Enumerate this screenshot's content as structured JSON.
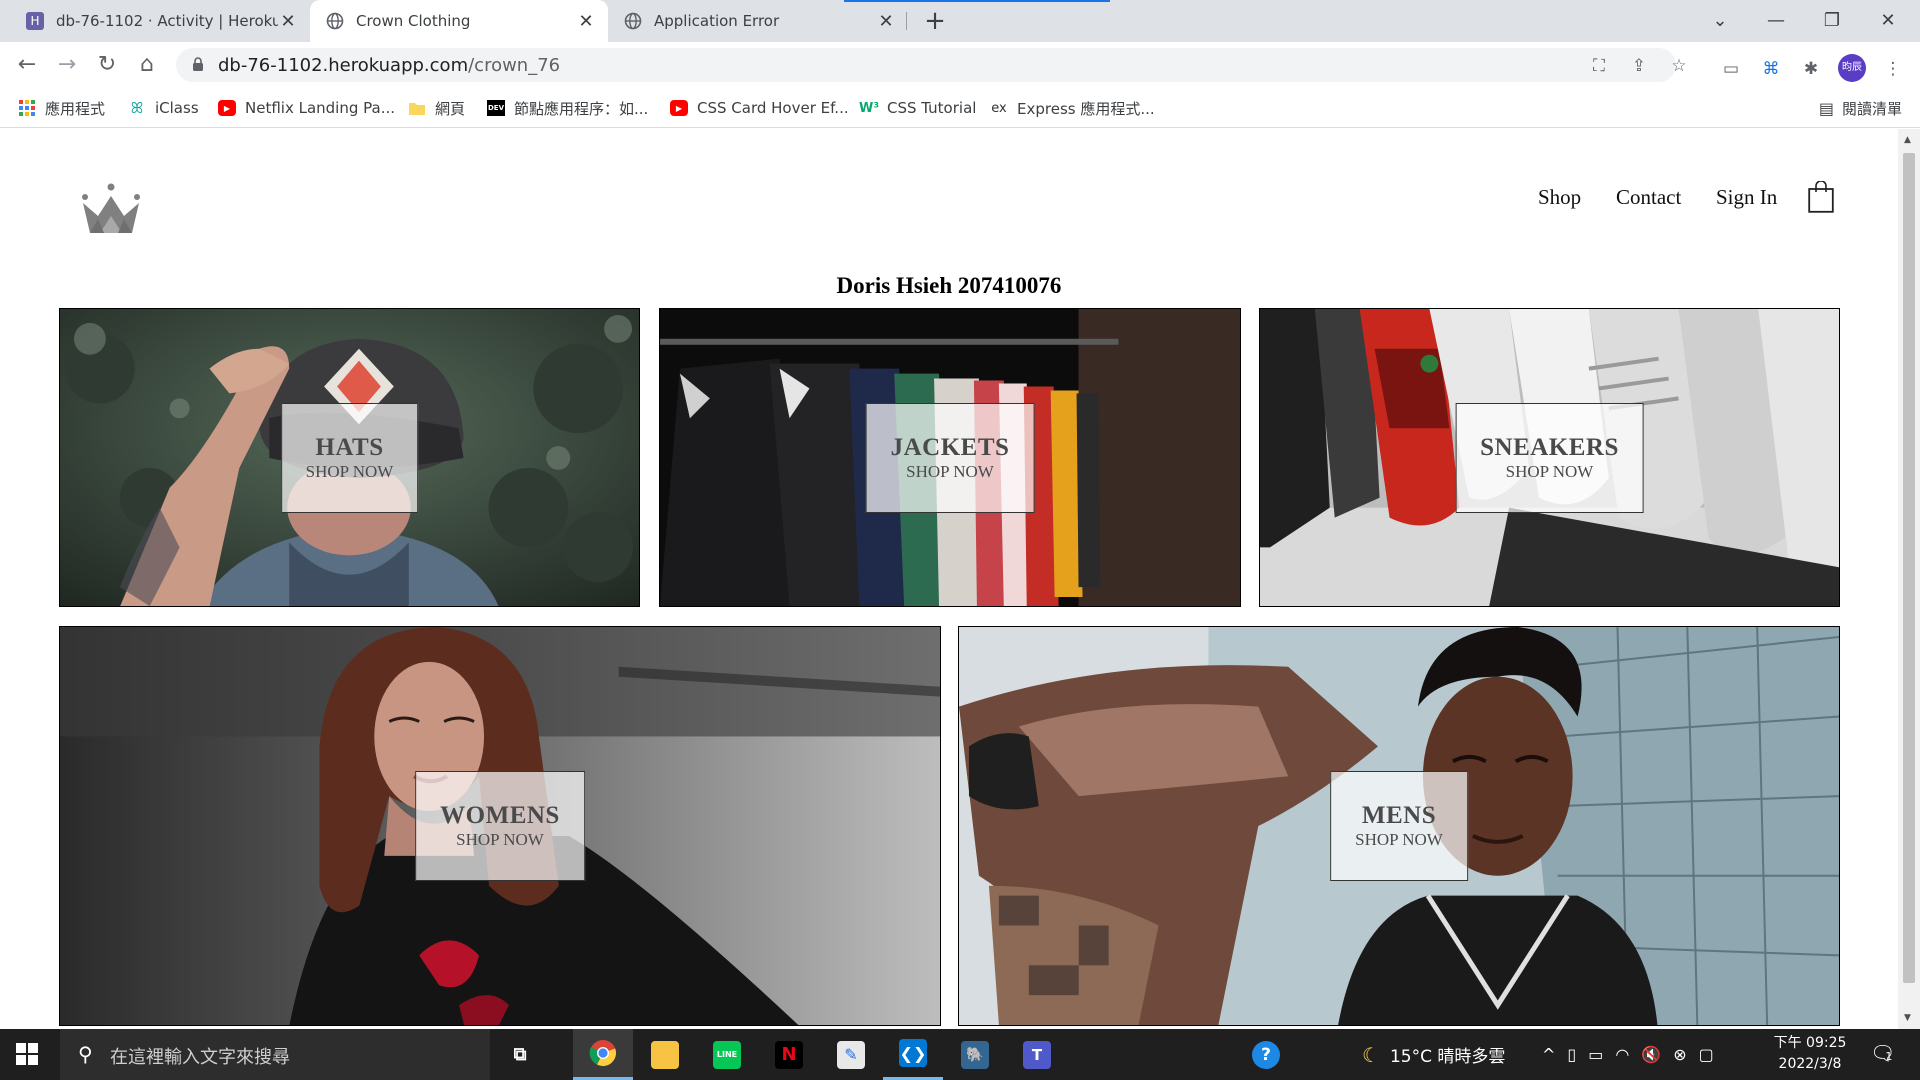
{
  "browser": {
    "tabs": [
      {
        "title": "db-76-1102 · Activity | Heroku",
        "favicon": "heroku-icon",
        "color": "#6762a6"
      },
      {
        "title": "Crown Clothing",
        "favicon": "globe-icon",
        "color": "#5f6368"
      },
      {
        "title": "Application Error",
        "favicon": "globe-icon",
        "color": "#5f6368"
      }
    ],
    "url_host": "db-76-1102.herokuapp.com",
    "url_path": "/crown_76",
    "bookmarks": [
      {
        "label": "應用程式",
        "icon": "apps-grid-icon"
      },
      {
        "label": "iClass",
        "icon": "iclass-icon"
      },
      {
        "label": "Netflix Landing Pa...",
        "icon": "youtube-icon"
      },
      {
        "label": "網頁",
        "icon": "folder-icon"
      },
      {
        "label": "節點應用程序：如...",
        "icon": "dev-icon"
      },
      {
        "label": "CSS Card Hover Ef...",
        "icon": "youtube-icon"
      },
      {
        "label": "CSS Tutorial",
        "icon": "w3schools-icon"
      },
      {
        "label": "Express 應用程式...",
        "icon": "express-icon"
      }
    ],
    "reading_list": "閱讀清單",
    "profile_initials": "昀辰"
  },
  "site": {
    "nav": {
      "shop": "Shop",
      "contact": "Contact",
      "sign_in": "Sign In"
    },
    "owner": "Doris Hsieh 207410076",
    "categories": [
      {
        "title": "HATS",
        "subtitle": "SHOP NOW"
      },
      {
        "title": "JACKETS",
        "subtitle": "SHOP NOW"
      },
      {
        "title": "SNEAKERS",
        "subtitle": "SHOP NOW"
      },
      {
        "title": "WOMENS",
        "subtitle": "SHOP NOW"
      },
      {
        "title": "MENS",
        "subtitle": "SHOP NOW"
      }
    ]
  },
  "taskbar": {
    "search_placeholder": "在這裡輸入文字來搜尋",
    "weather": "15°C  晴時多雲",
    "time": "下午 09:25",
    "date": "2022/3/8",
    "notification_count": "1"
  }
}
